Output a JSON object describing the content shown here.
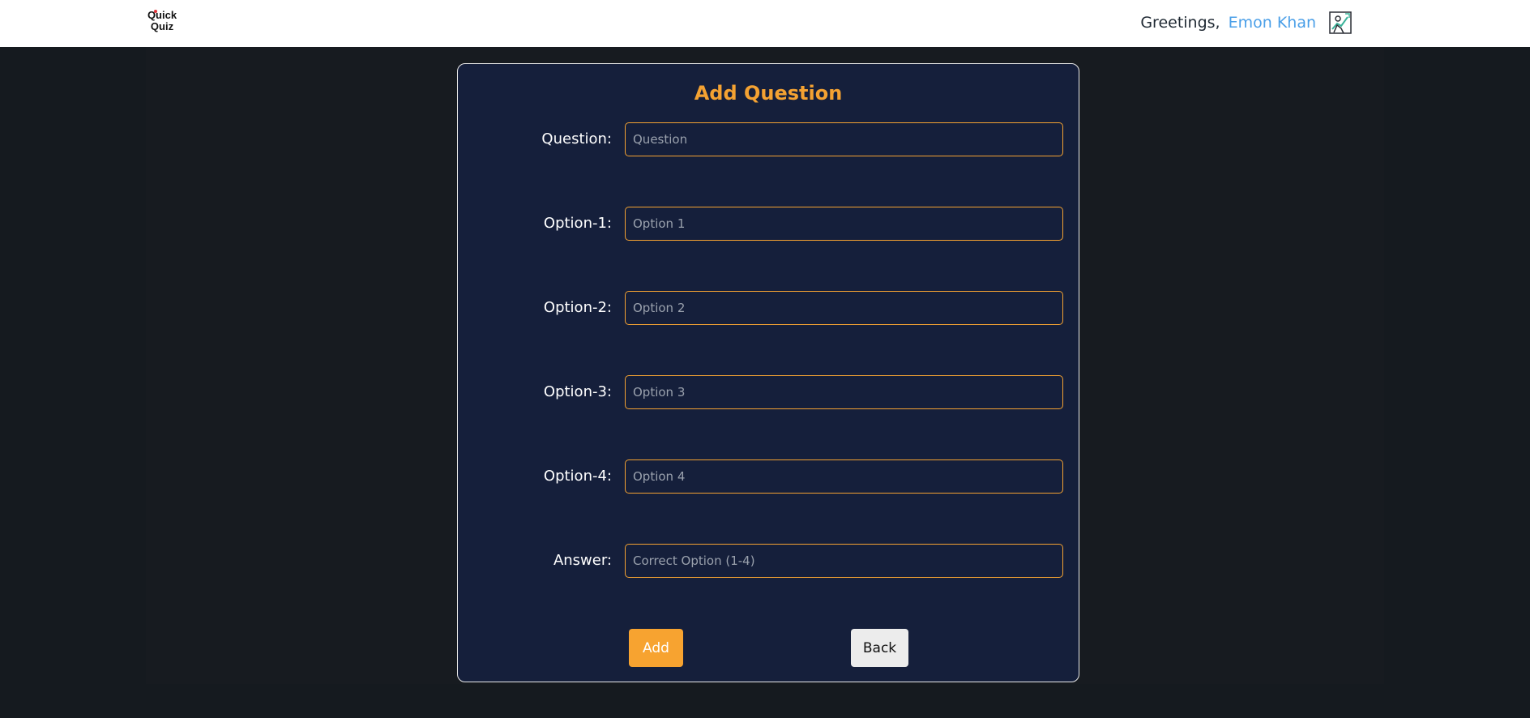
{
  "header": {
    "logo_line1": "Quick",
    "logo_line2": "Quiz",
    "greeting": "Greetings,",
    "user_name": "Emon Khan"
  },
  "form": {
    "title": "Add Question",
    "fields": [
      {
        "label": "Question:",
        "placeholder": "Question",
        "value": ""
      },
      {
        "label": "Option-1:",
        "placeholder": "Option 1",
        "value": ""
      },
      {
        "label": "Option-2:",
        "placeholder": "Option 2",
        "value": ""
      },
      {
        "label": "Option-3:",
        "placeholder": "Option 3",
        "value": ""
      },
      {
        "label": "Option-4:",
        "placeholder": "Option 4",
        "value": ""
      },
      {
        "label": "Answer:",
        "placeholder": "Correct Option (1-4)",
        "value": ""
      }
    ],
    "add_label": "Add",
    "back_label": "Back"
  },
  "colors": {
    "accent": "#f4a232",
    "card_bg": "#151f3b",
    "user_name": "#4a9fe8",
    "page_bg": "#151a1f"
  }
}
